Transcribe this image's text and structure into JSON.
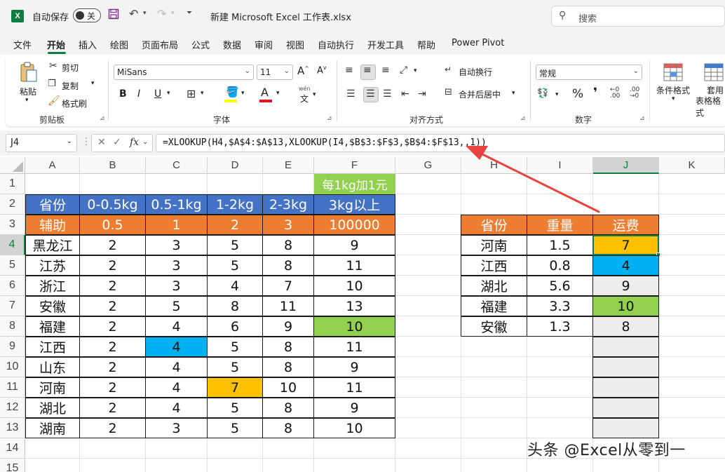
{
  "titlebar": {
    "logo": "X",
    "autosave_label": "自动保存",
    "autosave_state": "关",
    "doc_title": "新建 Microsoft Excel 工作表.xlsx",
    "search_placeholder": "搜索",
    "icons": [
      "save-icon",
      "undo-icon",
      "redo-icon",
      "customize-icon",
      "search-icon"
    ]
  },
  "menu": {
    "items": [
      "文件",
      "开始",
      "插入",
      "绘图",
      "页面布局",
      "公式",
      "数据",
      "审阅",
      "视图",
      "自动执行",
      "开发工具",
      "帮助",
      "Power Pivot"
    ],
    "active": "开始"
  },
  "ribbon": {
    "clipboard": {
      "label": "剪贴板",
      "paste": "粘贴",
      "cut": "剪切",
      "copy": "复制",
      "format_painter": "格式刷"
    },
    "font": {
      "label": "字体",
      "font_name": "MiSans",
      "font_size": "11",
      "bold": "B",
      "italic": "I",
      "underline": "U",
      "phonetic": "wén"
    },
    "alignment": {
      "label": "对齐方式",
      "wrap": "自动换行",
      "merge": "合并后居中"
    },
    "number": {
      "label": "数字",
      "format": "常规"
    },
    "styles": {
      "conditional": "条件格式",
      "table_1": "套用",
      "table_2": "表格格式"
    }
  },
  "formula_bar": {
    "cell_ref": "J4",
    "fx": "fx",
    "formula": "=XLOOKUP(H4,$A$4:$A$13,XLOOKUP(I4,$B$3:$F$3,$B$4:$F$13,,1))"
  },
  "colors": {
    "header_blue": "#4472c4",
    "aux_orange": "#ed7d31",
    "green": "#92d050",
    "cyan": "#00b0f0",
    "gold": "#ffc000",
    "gray": "#ededed",
    "excel_green": "#107c41",
    "arrow_red": "#e8433f"
  },
  "sheet": {
    "columns": [
      "A",
      "B",
      "C",
      "D",
      "E",
      "F",
      "G",
      "H",
      "I",
      "J",
      "K"
    ],
    "rows": [
      "1",
      "2",
      "3",
      "4",
      "5",
      "6",
      "7",
      "8",
      "9",
      "10",
      "11",
      "12",
      "13",
      "14",
      "15"
    ],
    "selected_column": "J",
    "selected_row": "4",
    "note": "每1kg加1元",
    "table1": {
      "headers": [
        "省份",
        "0-0.5kg",
        "0.5-1kg",
        "1-2kg",
        "2-3kg",
        "3kg以上"
      ],
      "aux": [
        "辅助",
        "0.5",
        "1",
        "2",
        "3",
        "100000"
      ],
      "rows": [
        [
          "黑龙江",
          "2",
          "3",
          "5",
          "8",
          "9"
        ],
        [
          "江苏",
          "2",
          "3",
          "5",
          "8",
          "11"
        ],
        [
          "浙江",
          "2",
          "3",
          "4",
          "7",
          "10"
        ],
        [
          "安徽",
          "2",
          "5",
          "8",
          "11",
          "13"
        ],
        [
          "福建",
          "2",
          "4",
          "6",
          "9",
          "10"
        ],
        [
          "江西",
          "2",
          "4",
          "5",
          "8",
          "11"
        ],
        [
          "山东",
          "2",
          "4",
          "5",
          "8",
          "9"
        ],
        [
          "河南",
          "2",
          "4",
          "7",
          "10",
          "11"
        ],
        [
          "湖北",
          "2",
          "4",
          "5",
          "8",
          "9"
        ],
        [
          "湖南",
          "2",
          "3",
          "5",
          "8",
          "10"
        ]
      ]
    },
    "table2": {
      "headers": [
        "省份",
        "重量",
        "运费"
      ],
      "rows": [
        [
          "河南",
          "1.5",
          "7"
        ],
        [
          "江西",
          "0.8",
          "4"
        ],
        [
          "湖北",
          "5.6",
          "9"
        ],
        [
          "福建",
          "3.3",
          "10"
        ],
        [
          "安徽",
          "1.3",
          "8"
        ]
      ]
    }
  },
  "watermark": "头条 @Excel从零到一"
}
